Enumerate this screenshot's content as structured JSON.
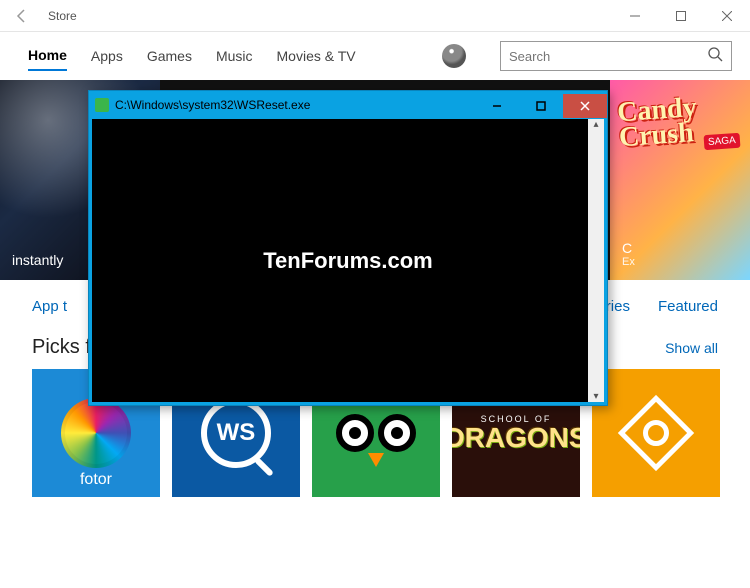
{
  "window": {
    "title": "Store"
  },
  "nav": {
    "items": [
      "Home",
      "Apps",
      "Games",
      "Music",
      "Movies & TV"
    ],
    "activeIndex": 0
  },
  "search": {
    "placeholder": "Search",
    "value": ""
  },
  "hero": {
    "left_label": "instantly",
    "right_title": "Candy Crush",
    "right_badge": "SAGA",
    "right_label_char": "C",
    "right_sublabel": "Ex"
  },
  "tabs": {
    "left": "App t",
    "mid": "egories",
    "right": "Featured"
  },
  "picks": {
    "title": "Picks for you",
    "show_all": "Show all",
    "tiles": [
      {
        "label": "fotor"
      },
      {
        "label": "WS"
      },
      {
        "label": ""
      },
      {
        "label_top": "SCHOOL OF",
        "label_main": "DRAGONS"
      },
      {
        "label": ""
      }
    ]
  },
  "console": {
    "title": "C:\\Windows\\system32\\WSReset.exe",
    "watermark": "TenForums.com"
  }
}
